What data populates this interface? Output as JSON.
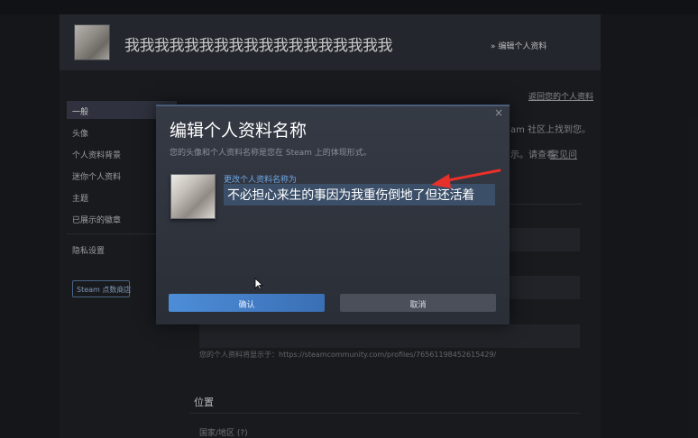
{
  "header": {
    "profile_name": "我我我我我我我我我我我我我我我我我我",
    "subtitle": "» 编辑个人资料"
  },
  "back_link": "返回您的个人资料",
  "sidebar": {
    "items": [
      {
        "label": "一般",
        "active": true
      },
      {
        "label": "头像"
      },
      {
        "label": "个人资料背景"
      },
      {
        "label": "迷你个人资料"
      },
      {
        "label": "主题"
      },
      {
        "label": "已展示的徽章"
      },
      {
        "label": "隐私设置"
      }
    ],
    "store_button": "Steam 点数商店"
  },
  "background": {
    "snippet_1": "am 社区上找到您。",
    "snippet_2": "示。请查看",
    "snippet_2_link": "常见问",
    "profile_url_text": "您的个人资料将显示于：https://steamcommunity.com/profiles/76561198452615429/",
    "location_title": "位置",
    "region_label": "国家/地区 (?)"
  },
  "dialog": {
    "title": "编辑个人资料名称",
    "description": "您的头像和个人资料名称是您在 Steam 上的体现形式。",
    "field_label": "更改个人资料名称为",
    "name_value": "不必担心来生的事因为我重伤倒地了但还活着",
    "confirm_label": "确认",
    "cancel_label": "取消",
    "close_glyph": "×"
  },
  "colors": {
    "accent_blue": "#4d8dd8",
    "annotation_red": "#e8302a"
  }
}
